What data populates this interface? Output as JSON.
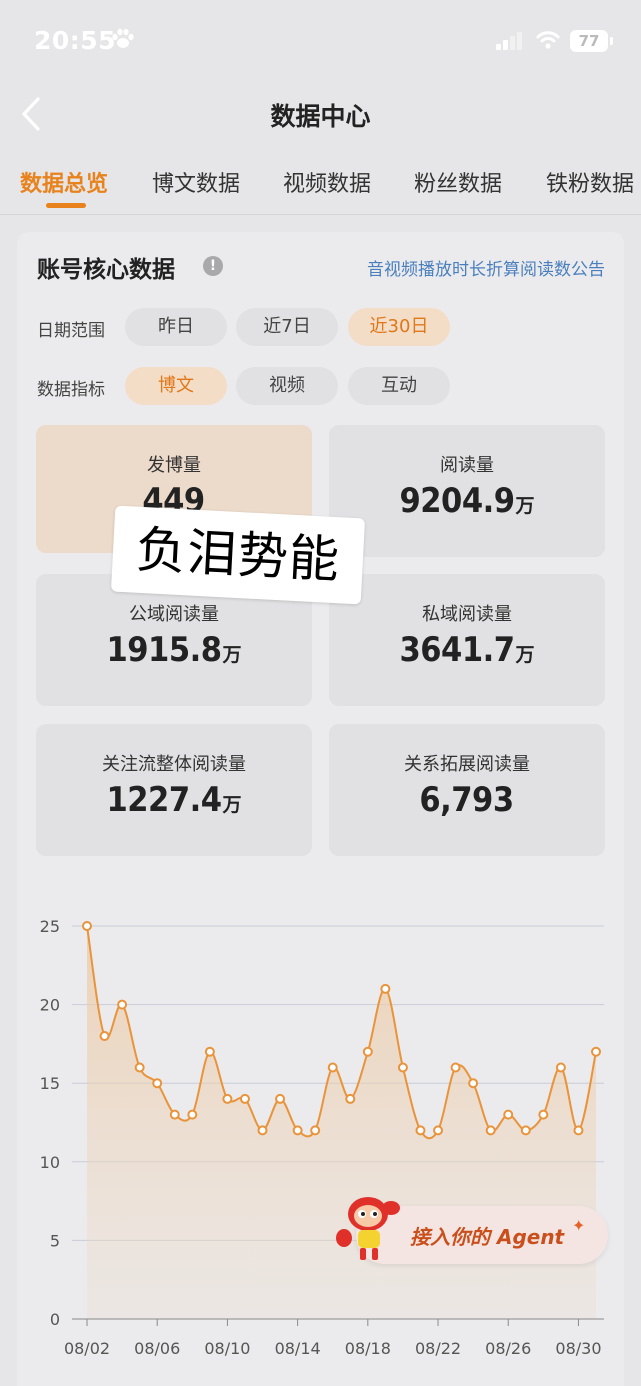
{
  "status_bar": {
    "time": "20:55",
    "battery": "77"
  },
  "nav": {
    "title": "数据中心"
  },
  "tabs": [
    {
      "label": "数据总览",
      "active": true
    },
    {
      "label": "博文数据",
      "active": false
    },
    {
      "label": "视频数据",
      "active": false
    },
    {
      "label": "粉丝数据",
      "active": false
    },
    {
      "label": "铁粉数据",
      "active": false
    }
  ],
  "card": {
    "title": "账号核心数据",
    "info_icon": "!",
    "notice": "音视频播放时长折算阅读数公告"
  },
  "date_range": {
    "label": "日期范围",
    "options": [
      "昨日",
      "近7日",
      "近30日"
    ],
    "selected": "近30日"
  },
  "metric": {
    "label": "数据指标",
    "options": [
      "博文",
      "视频",
      "互动"
    ],
    "selected": "博文"
  },
  "stats": [
    {
      "label": "发博量",
      "value": "449",
      "unit": "",
      "active": true
    },
    {
      "label": "阅读量",
      "value": "9204.9",
      "unit": "万",
      "active": false
    },
    {
      "label": "公域阅读量",
      "value": "1915.8",
      "unit": "万",
      "active": false
    },
    {
      "label": "私域阅读量",
      "value": "3641.7",
      "unit": "万",
      "active": false
    },
    {
      "label": "关注流整体阅读量",
      "value": "1227.4",
      "unit": "万",
      "active": false
    },
    {
      "label": "关系拓展阅读量",
      "value": "6,793",
      "unit": "",
      "active": false
    }
  ],
  "sticker": {
    "text": "负泪势能"
  },
  "agent_banner": {
    "text": "接入你的 Agent"
  },
  "colors": {
    "accent": "#e8821c",
    "line": "#e9933a",
    "link": "#4a7fbd"
  },
  "chart_data": {
    "type": "area",
    "x": [
      "08/02",
      "08/03",
      "08/04",
      "08/05",
      "08/06",
      "08/07",
      "08/08",
      "08/09",
      "08/10",
      "08/11",
      "08/12",
      "08/13",
      "08/14",
      "08/15",
      "08/16",
      "08/17",
      "08/18",
      "08/19",
      "08/20",
      "08/21",
      "08/22",
      "08/23",
      "08/24",
      "08/25",
      "08/26",
      "08/27",
      "08/28",
      "08/29",
      "08/30",
      "08/31"
    ],
    "values": [
      25,
      18,
      20,
      16,
      15,
      13,
      13,
      17,
      14,
      14,
      12,
      14,
      12,
      12,
      16,
      14,
      17,
      21,
      16,
      12,
      12,
      16,
      15,
      12,
      13,
      12,
      13,
      16,
      12,
      17
    ],
    "x_tick_labels": [
      "08/02",
      "08/06",
      "08/10",
      "08/14",
      "08/18",
      "08/22",
      "08/26",
      "08/30"
    ],
    "y_ticks": [
      0,
      5,
      10,
      15,
      20,
      25
    ],
    "ylim": [
      0,
      25
    ],
    "grid": true
  }
}
